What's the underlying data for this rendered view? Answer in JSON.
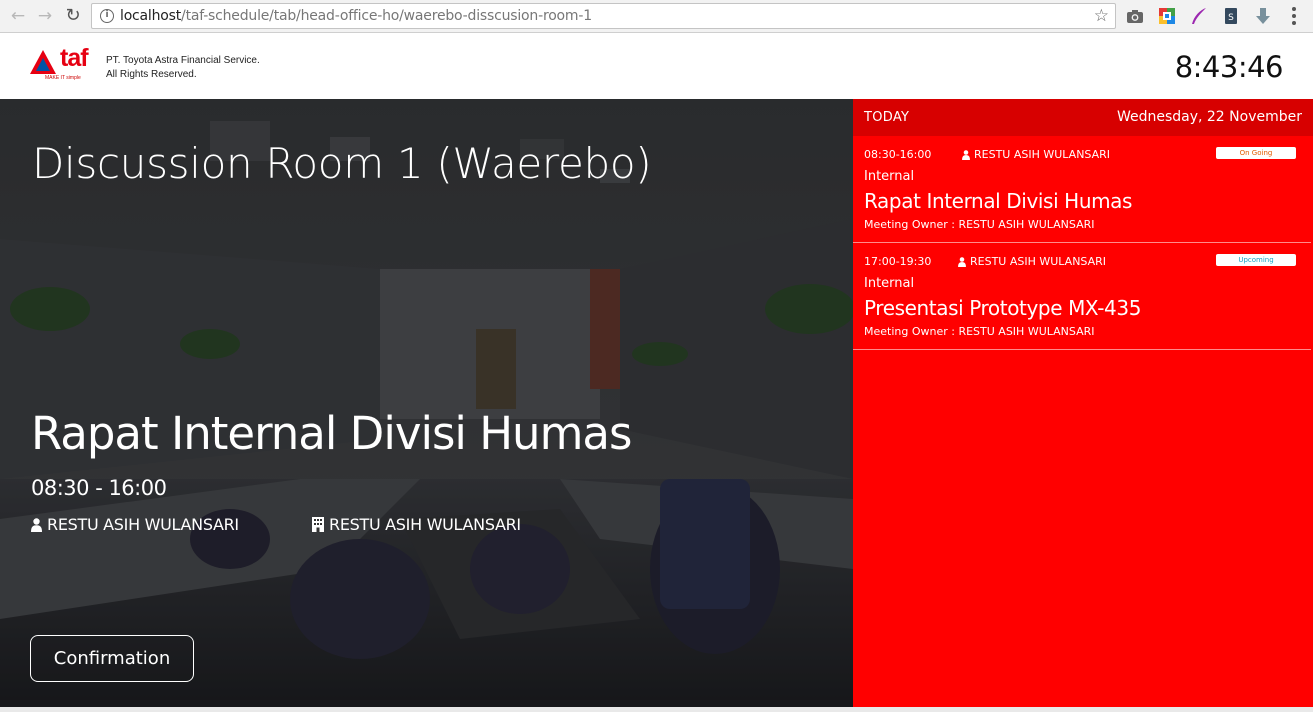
{
  "browser": {
    "url_host": "localhost",
    "url_path": "/taf-schedule/tab/head-office-ho/waerebo-disscusion-room-1",
    "info_icon": "info-icon",
    "star_icon": "star-icon"
  },
  "header": {
    "logo_text": "taf",
    "logo_tagline": "MAKE IT simple",
    "company_line1": "PT. Toyota Astra Financial Service.",
    "company_line2": "All Rights Reserved.",
    "clock": "8:43:46"
  },
  "room": {
    "name": "Discussion Room 1 (Waerebo)",
    "current_meeting": {
      "title": "Rapat Internal Divisi Humas",
      "time": "08:30 - 16:00",
      "owner": "RESTU ASIH WULANSARI",
      "department": "RESTU ASIH WULANSARI"
    },
    "confirm_label": "Confirmation"
  },
  "schedule": {
    "today_label": "TODAY",
    "date": "Wednesday, 22 November",
    "events": [
      {
        "time": "08:30-16:00",
        "owner": "RESTU ASIH WULANSARI",
        "status": "On Going",
        "type": "Internal",
        "title": "Rapat Internal Divisi Humas",
        "owner_line": "Meeting Owner : RESTU ASIH WULANSARI"
      },
      {
        "time": "17:00-19:30",
        "owner": "RESTU ASIH WULANSARI",
        "status": "Upcoming",
        "type": "Internal",
        "title": "Presentasi Prototype MX-435",
        "owner_line": "Meeting Owner : RESTU ASIH WULANSARI"
      }
    ]
  },
  "colors": {
    "sidebar_red": "#ff0000",
    "sidebar_header_red": "#d70000",
    "ongoing_orange": "#e25b00",
    "upcoming_blue": "#19a3c6"
  }
}
